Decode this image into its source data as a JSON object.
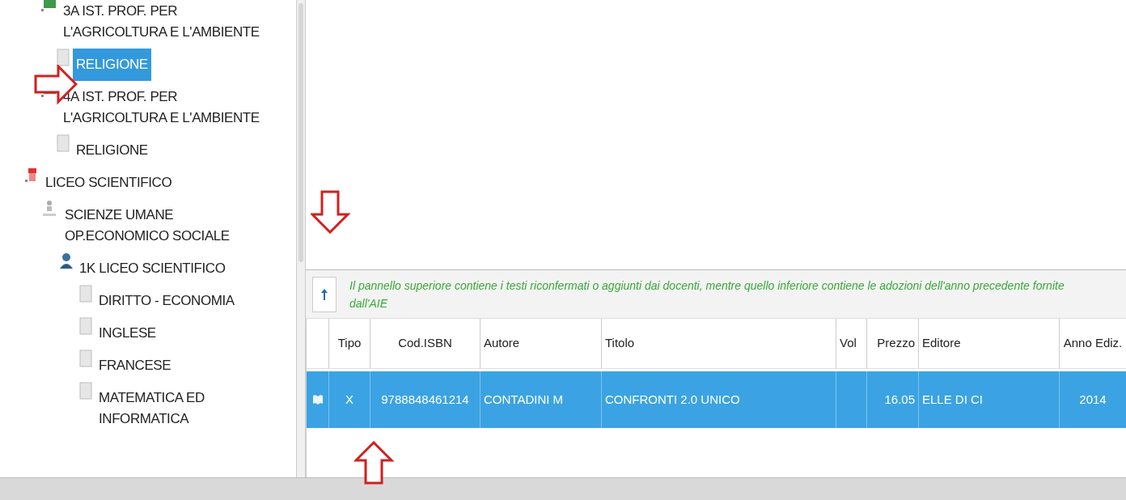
{
  "tree": [
    {
      "children": [
        {
          "kind": "class",
          "label": "3A IST. PROF. PER L'AGRICOLTURA E L'AMBIENTE",
          "children": [
            {
              "kind": "subject",
              "label": "RELIGIONE",
              "selected": true
            }
          ]
        },
        {
          "kind": "class",
          "label": "4A IST. PROF. PER L'AGRICOLTURA E L'AMBIENTE",
          "children": [
            {
              "kind": "subject",
              "label": "RELIGIONE",
              "selected": false
            }
          ]
        }
      ]
    },
    {
      "kind": "school",
      "label": "LICEO SCIENTIFICO",
      "children": [
        {
          "kind": "course",
          "label": "SCIENZE UMANE OP.ECONOMICO SOCIALE",
          "children": [
            {
              "kind": "person",
              "label": "1K LICEO SCIENTIFICO",
              "children": [
                {
                  "kind": "subject",
                  "label": "DIRITTO - ECONOMIA",
                  "selected": false
                },
                {
                  "kind": "subject",
                  "label": "INGLESE",
                  "selected": false
                },
                {
                  "kind": "subject",
                  "label": "FRANCESE",
                  "selected": false
                },
                {
                  "kind": "subject",
                  "label": "MATEMATICA ED INFORMATICA",
                  "selected": false
                }
              ]
            }
          ]
        }
      ]
    }
  ],
  "message": "Il pannello superiore contiene i testi riconfermati o aggiunti dai docenti, mentre quello inferiore contiene le adozioni dell'anno precedente fornite dall'AIE",
  "table": {
    "columns": [
      "Tipo",
      "Cod.ISBN",
      "Autore",
      "Titolo",
      "Vol",
      "Prezzo",
      "Editore",
      "Anno Ediz."
    ],
    "rows": [
      {
        "selected": true,
        "cells": [
          "X",
          "9788848461214",
          "CONTADINI M",
          "CONFRONTI 2.0 UNICO",
          "",
          "16.05",
          "ELLE DI CI",
          "2014"
        ]
      }
    ]
  }
}
